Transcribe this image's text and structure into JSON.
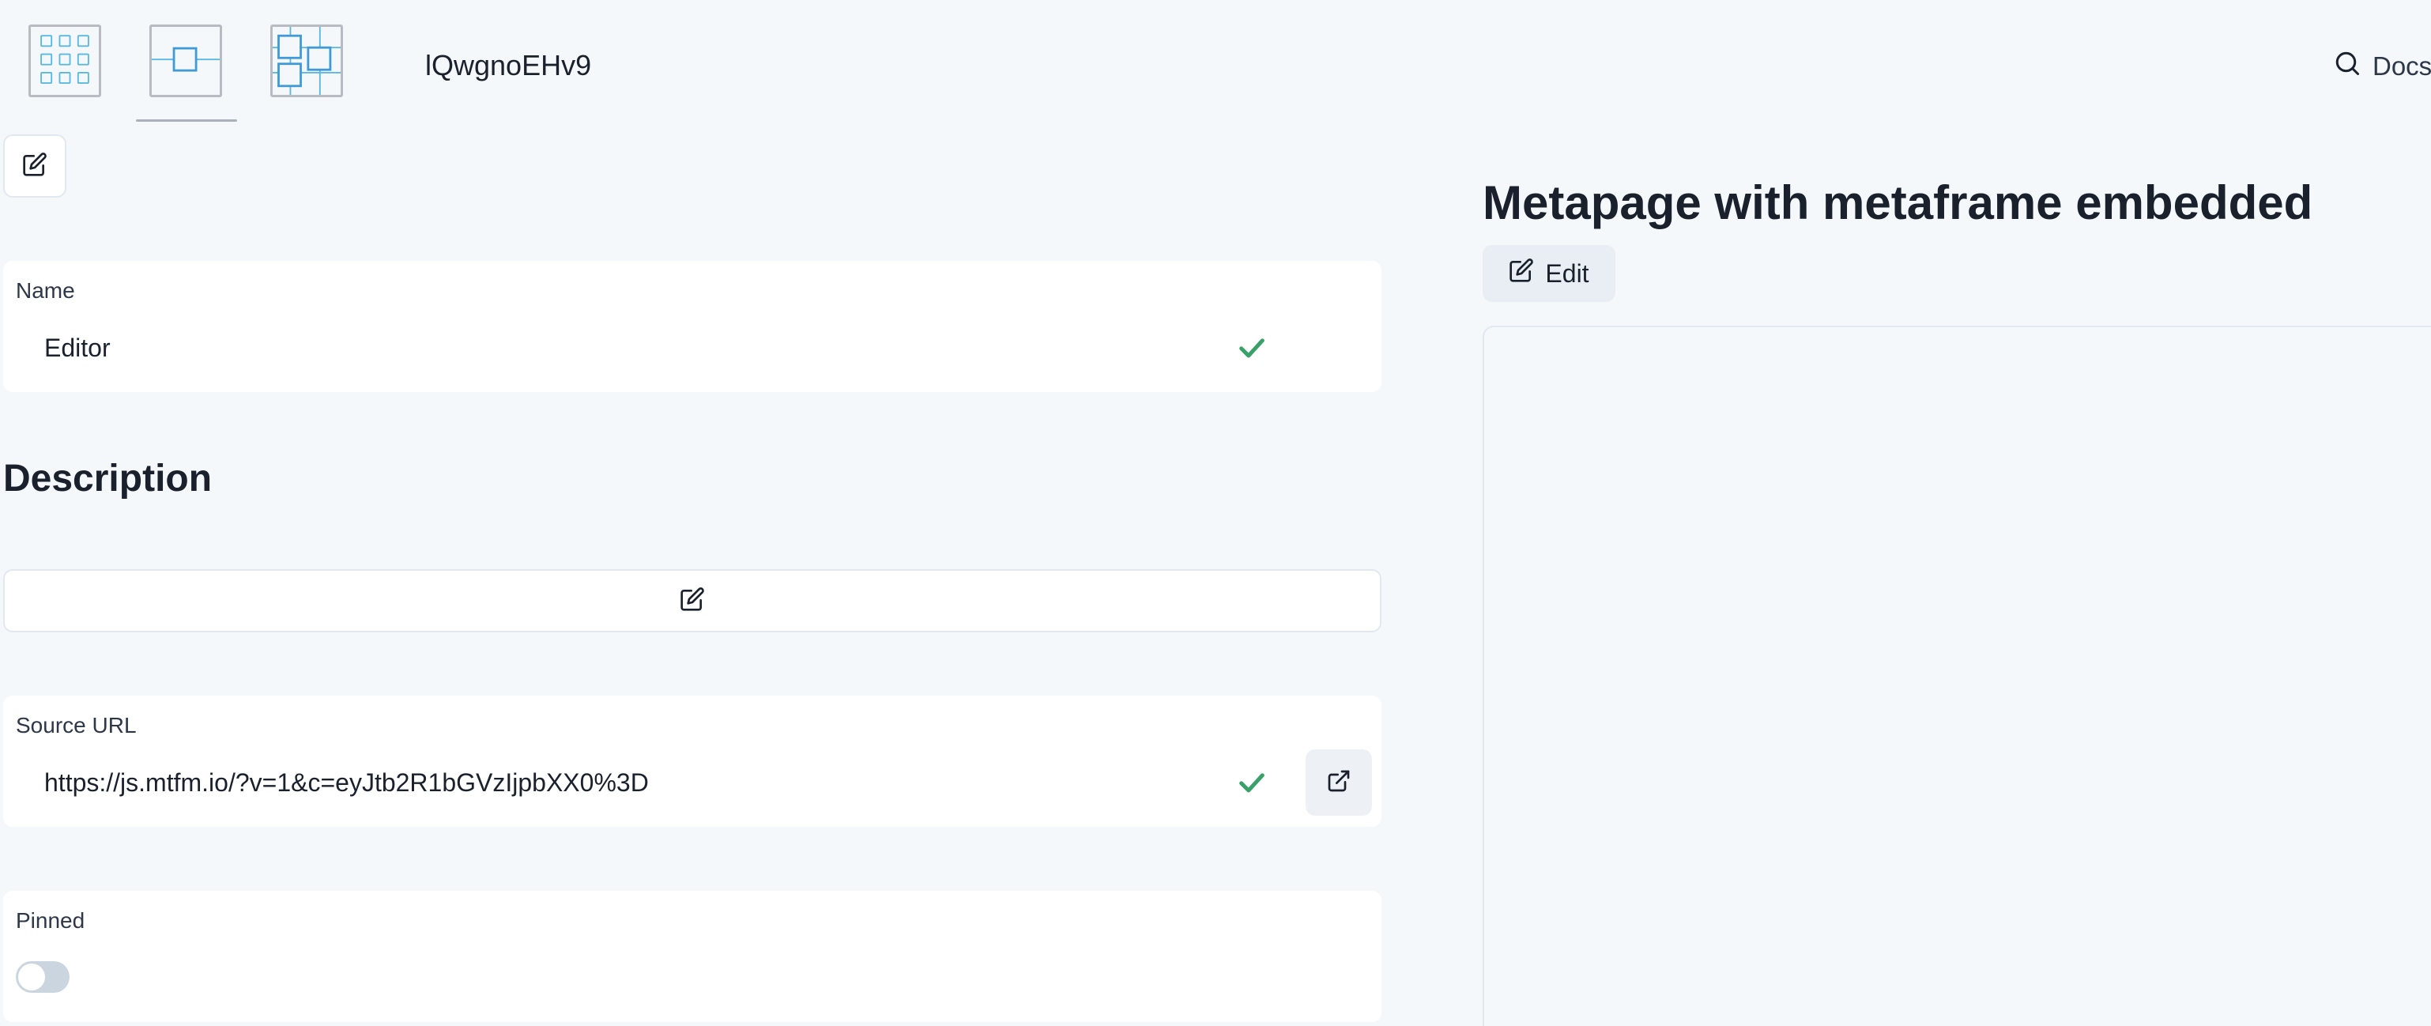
{
  "header": {
    "page_id": "lQwgnoEHv9",
    "docs_label": "Docs",
    "view_icons": [
      "grid-view-icon",
      "single-frame-view-icon",
      "graph-view-icon"
    ]
  },
  "form": {
    "name": {
      "label": "Name",
      "value": "Editor"
    },
    "description": {
      "heading": "Description"
    },
    "source_url": {
      "label": "Source URL",
      "value": "https://js.mtfm.io/?v=1&c=eyJtb2R1bGVzIjpbXX0%3D"
    },
    "pinned": {
      "label": "Pinned",
      "enabled": false
    }
  },
  "preview": {
    "title": "Metapage with metaframe embedded",
    "edit_label": "Edit"
  },
  "colors": {
    "accent_icon": "#3f9ad6",
    "check_green": "#38a169",
    "page_bg": "#f5f8fb"
  }
}
